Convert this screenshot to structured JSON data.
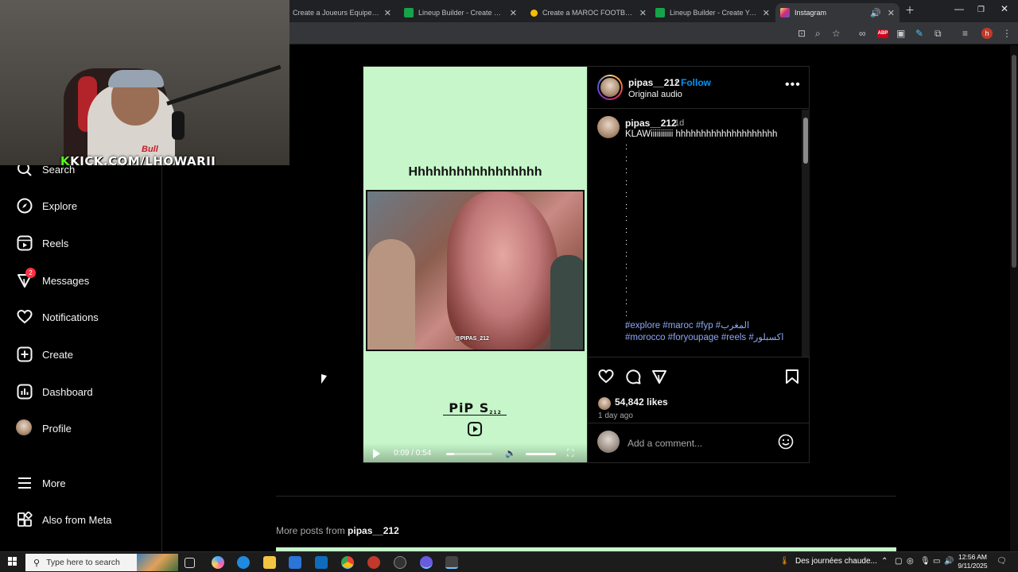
{
  "browser": {
    "tabs": [
      {
        "title": "Create a Joueurs Equipe Nation",
        "favicon_color": "#fbbc04"
      },
      {
        "title": "Lineup Builder - Create Your Sq",
        "favicon_color": "#16a34a"
      },
      {
        "title": "Create a MAROC FOOTBALL / T",
        "favicon_color": "#fbbc04"
      },
      {
        "title": "Lineup Builder - Create Your Sq",
        "favicon_color": "#16a34a"
      },
      {
        "title": "Instagram",
        "favicon_color": "#e1306c"
      }
    ],
    "profile_initial": "h",
    "extension_badge": "ABP"
  },
  "stream": {
    "overlay_prefix": "K",
    "overlay_url": "KICK.COM/LHOWARII",
    "shirt_text": "Bull"
  },
  "nav": {
    "items": [
      {
        "label": "Search",
        "icon": "search-icon"
      },
      {
        "label": "Explore",
        "icon": "compass-icon"
      },
      {
        "label": "Reels",
        "icon": "reels-icon"
      },
      {
        "label": "Messages",
        "icon": "messenger-icon",
        "badge": "2"
      },
      {
        "label": "Notifications",
        "icon": "heart-icon"
      },
      {
        "label": "Create",
        "icon": "plus-square-icon"
      },
      {
        "label": "Dashboard",
        "icon": "chart-icon"
      },
      {
        "label": "Profile",
        "icon": "avatar-icon"
      },
      {
        "label": "More",
        "icon": "menu-icon"
      },
      {
        "label": "Also from Meta",
        "icon": "meta-apps-icon"
      }
    ]
  },
  "post": {
    "media": {
      "title": "Hhhhhhhhhhhhhhhhh",
      "watermark": "@PIPAS_212",
      "logo": "PiP S",
      "logo_sub": "212",
      "time": "0:09 / 0:54",
      "progress": 0.17
    },
    "header": {
      "username": "pipas__212",
      "separator": "•",
      "follow": "Follow",
      "audio": "Original audio",
      "more": "•••"
    },
    "caption": {
      "username": "pipas__212",
      "age": "1d",
      "text": "KLAWiiiiiiiiiii hhhhhhhhhhhhhhhhhhhh",
      "dots": [
        ":",
        ":",
        ":",
        ":",
        ":",
        ":",
        ":",
        ":",
        ":",
        ":",
        ":",
        ":",
        ":",
        ":",
        ":",
        ":"
      ],
      "tags_line1": "#explore #maroc #fyp #المغرب",
      "tags_line2": "#morocco #foryoupage #reels #اكسبلور"
    },
    "likes": "54,842 likes",
    "posted": "1 day ago",
    "comment_placeholder": "Add a comment...",
    "more_posts_prefix": "More posts from ",
    "more_posts_user": "pipas__212"
  },
  "taskbar": {
    "search_placeholder": "Type here to search",
    "weather": "Des journées chaude...",
    "time": "12:56 AM",
    "date": "9/11/2025"
  }
}
